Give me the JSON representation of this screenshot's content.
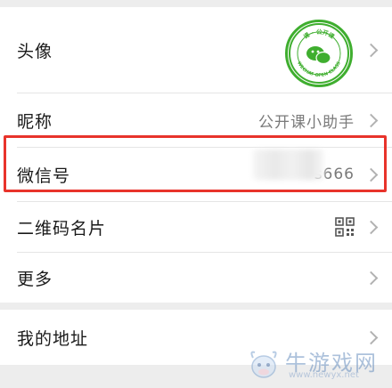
{
  "profile": {
    "avatar": {
      "label": "头像",
      "logo_lines": [
        "课 · 公开课",
        "WECHAT OPEN CLASS"
      ]
    },
    "nickname": {
      "label": "昵称",
      "value": "公开课小助手"
    },
    "wechat_id": {
      "label": "微信号",
      "value_visible_suffix": "s666"
    },
    "qr_code": {
      "label": "二维码名片",
      "icon": "qr-code-icon"
    },
    "more": {
      "label": "更多"
    }
  },
  "address": {
    "label": "我的地址"
  },
  "watermark": {
    "text": "牛游戏网",
    "url": "www.newyx.net"
  },
  "colors": {
    "highlight": "#e8332b",
    "avatar_green": "#3fae2f",
    "background": "#ededed"
  }
}
